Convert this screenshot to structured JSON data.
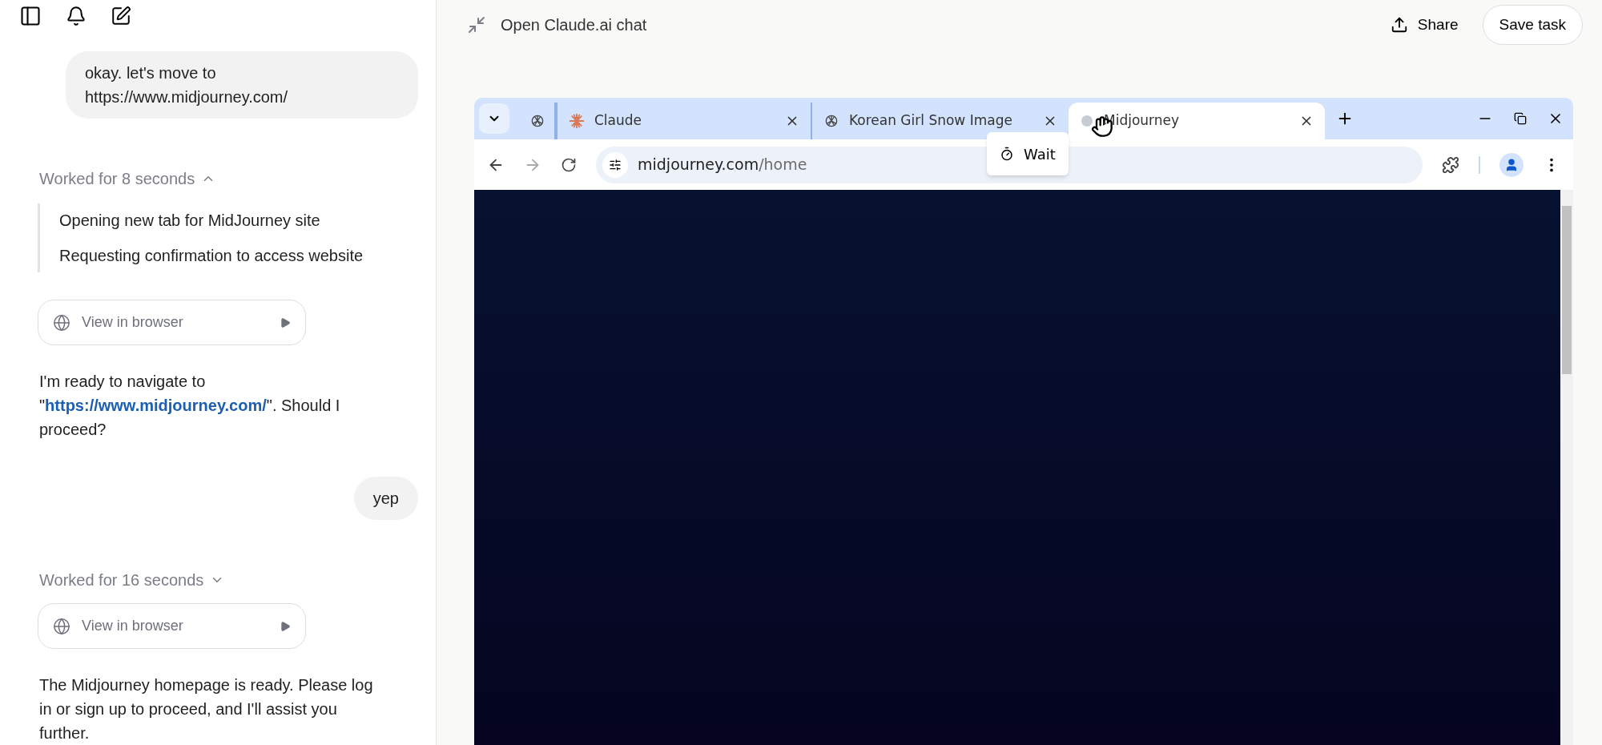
{
  "header": {
    "title": "Open Claude.ai chat",
    "share": "Share",
    "save": "Save task"
  },
  "messages": [
    {
      "kind": "user",
      "text": "okay. let's move to https://www.midjourney.com/"
    },
    {
      "kind": "worklog",
      "label": "Worked for 8 seconds",
      "expanded": true,
      "steps": [
        "Opening new tab for MidJourney site",
        "Requesting confirmation to access website"
      ]
    },
    {
      "kind": "browser_card",
      "label": "View in browser"
    },
    {
      "kind": "assistant",
      "before": "I'm ready to navigate to \"",
      "link": "https://www.midjourney.com/",
      "after": "\". Should I proceed?"
    },
    {
      "kind": "user",
      "text": "yep"
    },
    {
      "kind": "worklog",
      "label": "Worked for 16 seconds",
      "expanded": false
    },
    {
      "kind": "browser_card",
      "label": "View in browser"
    },
    {
      "kind": "assistant",
      "before": "The Midjourney homepage is ready. Please log in or sign up to proceed, and I'll assist you further."
    }
  ],
  "browser": {
    "tabs": [
      {
        "kind": "pinned",
        "selected": false
      },
      {
        "kind": "normal",
        "title": "Claude",
        "selected": false
      },
      {
        "kind": "normal",
        "title": "Korean Girl Snow Image",
        "selected": false
      },
      {
        "kind": "normal",
        "title": "Midjourney",
        "selected": true
      }
    ],
    "tooltip": "Wait",
    "url_host": "midjourney.com",
    "url_path": "/home"
  }
}
